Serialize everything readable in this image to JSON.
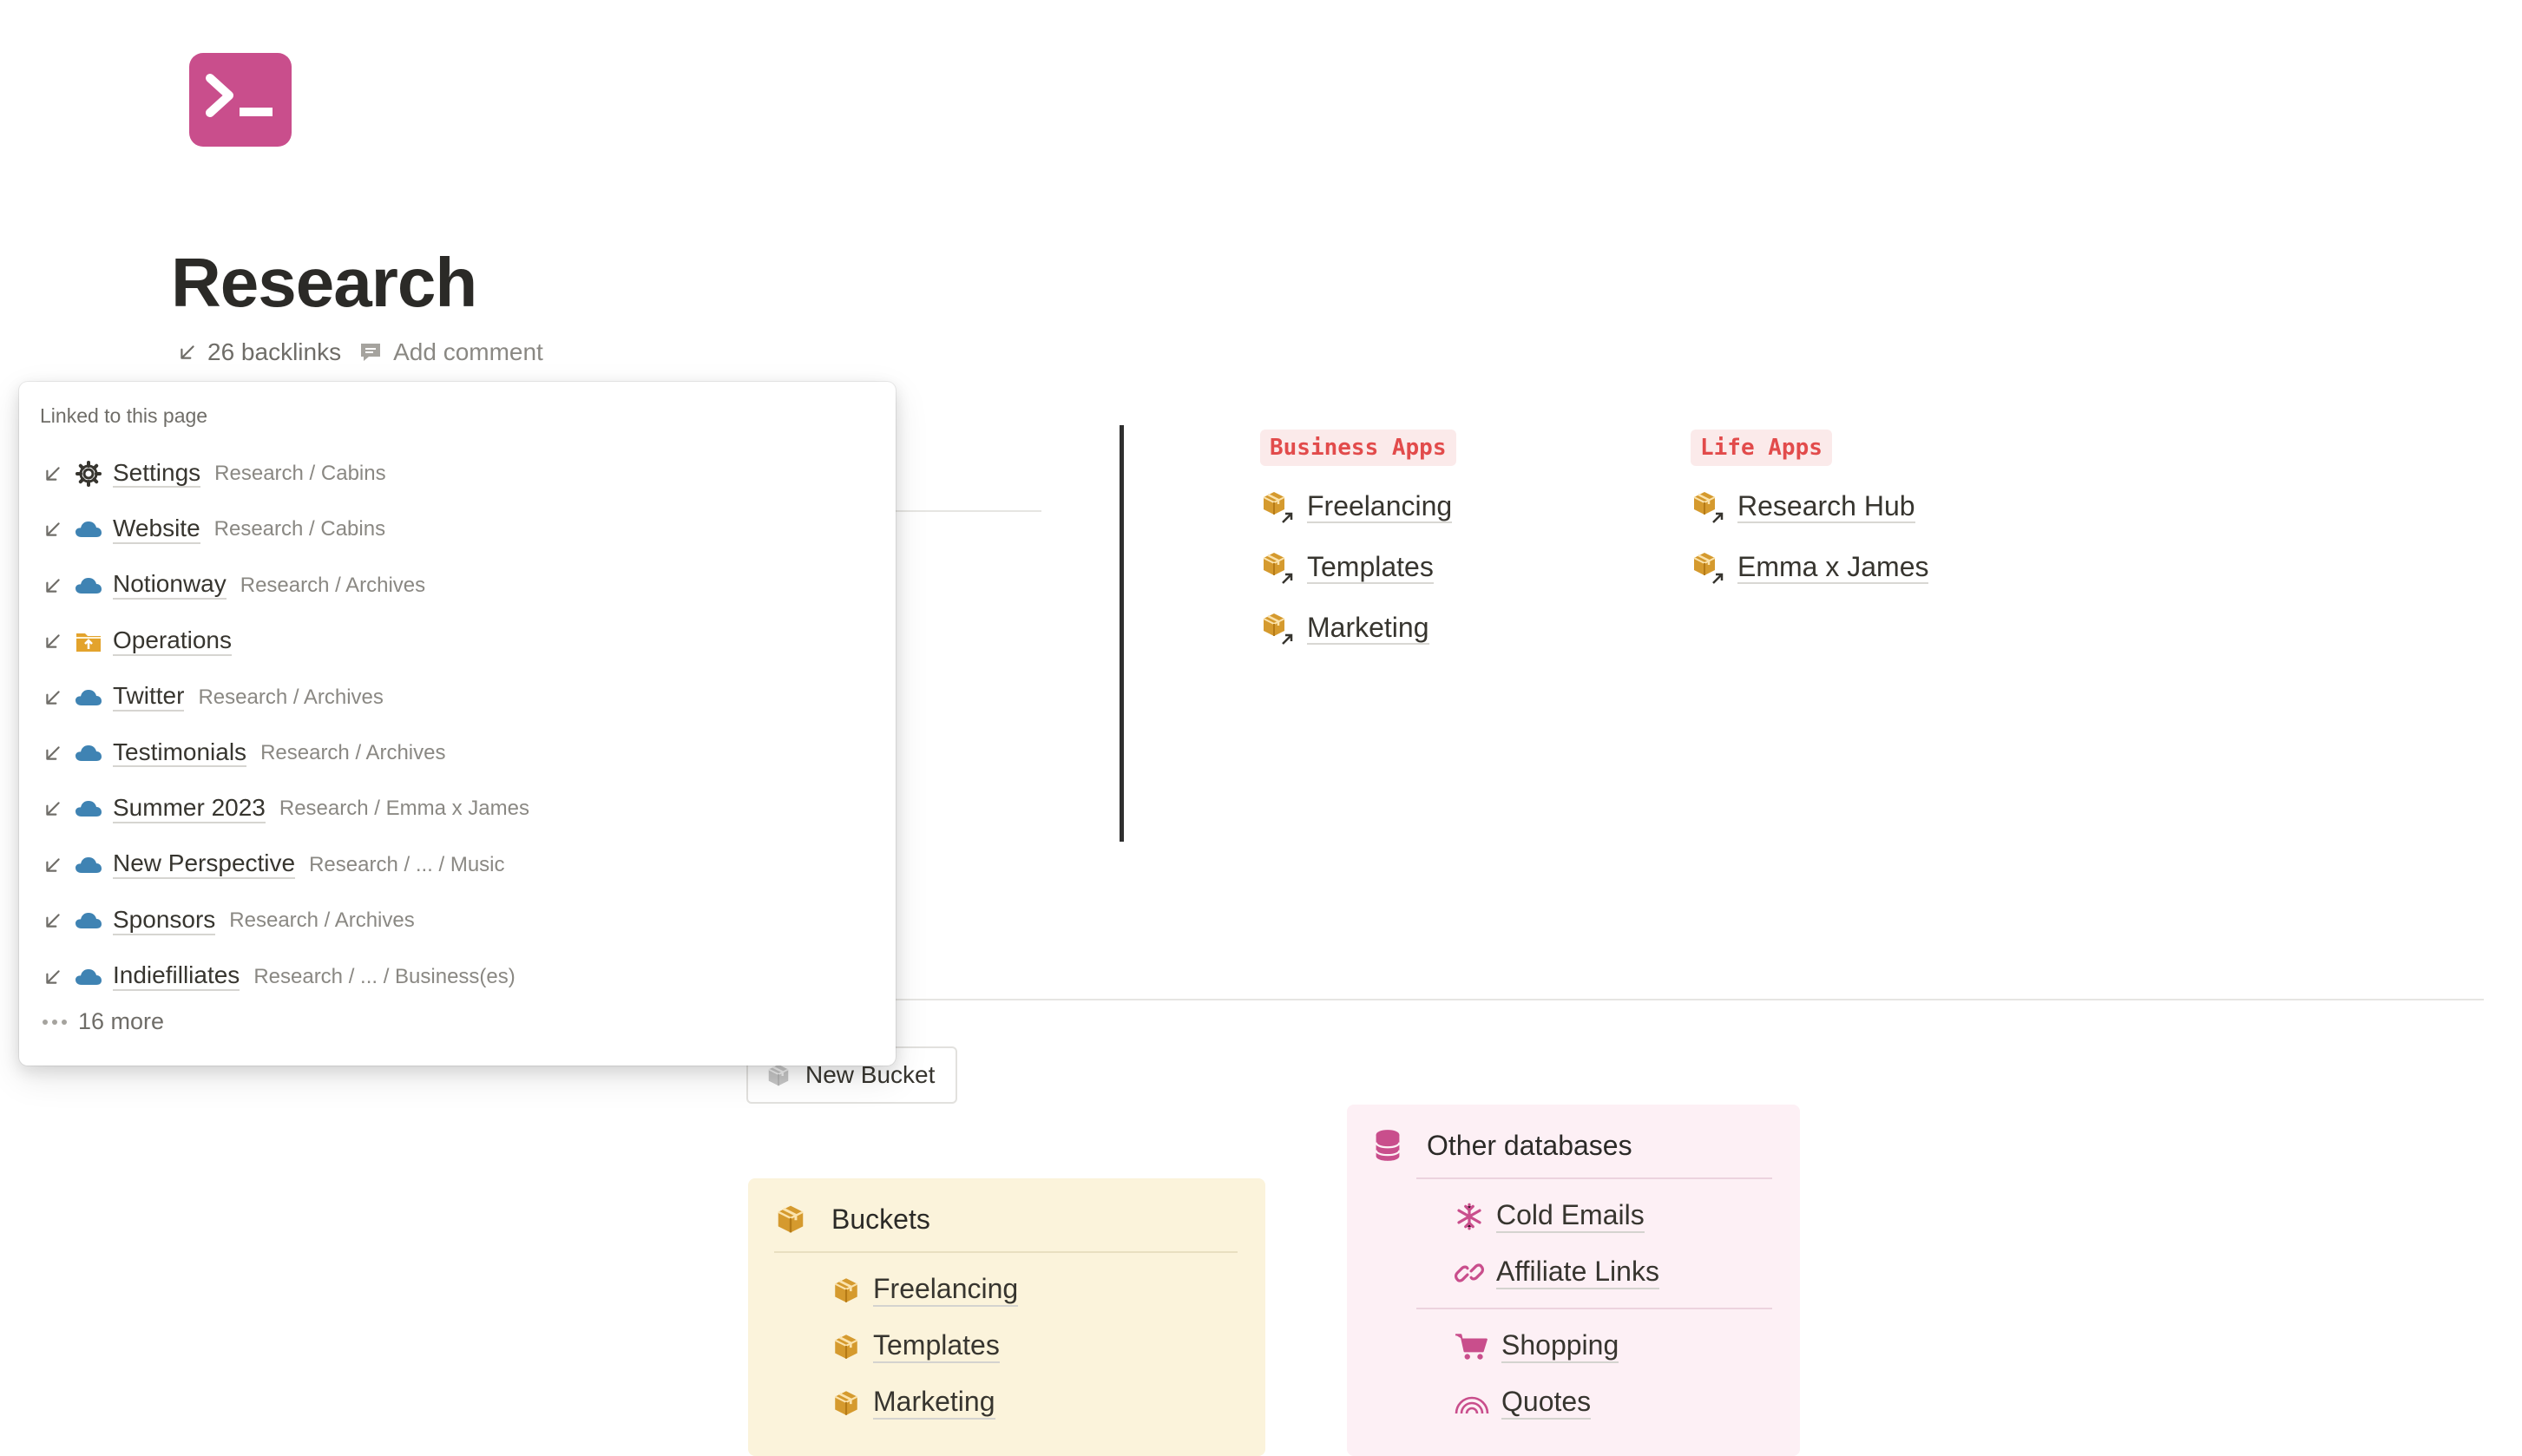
{
  "page": {
    "title": "Research",
    "backlinks_label": "26 backlinks",
    "add_comment_label": "Add comment",
    "icon": "terminal-icon",
    "accent_color": "#c94e8c"
  },
  "apps": {
    "business": {
      "tag": "Business Apps",
      "items": [
        {
          "label": "Freelancing",
          "icon": "box-link-icon"
        },
        {
          "label": "Templates",
          "icon": "box-link-icon"
        },
        {
          "label": "Marketing",
          "icon": "box-link-icon"
        }
      ]
    },
    "life": {
      "tag": "Life Apps",
      "items": [
        {
          "label": "Research Hub",
          "icon": "box-link-icon"
        },
        {
          "label": "Emma x James",
          "icon": "box-link-icon"
        }
      ]
    }
  },
  "new_bucket": {
    "label": "New Bucket"
  },
  "buckets": {
    "title": "Buckets",
    "bg_color": "#fbf3db",
    "items": [
      "Freelancing",
      "Templates",
      "Marketing"
    ]
  },
  "other_databases": {
    "title": "Other databases",
    "bg_color": "#fdf0f5",
    "group1": [
      {
        "label": "Cold Emails",
        "icon": "snowflake-icon"
      },
      {
        "label": "Affiliate Links",
        "icon": "link-icon"
      }
    ],
    "group2": [
      {
        "label": "Shopping",
        "icon": "cart-icon"
      },
      {
        "label": "Quotes",
        "icon": "rainbow-icon"
      }
    ]
  },
  "backlinks_popup": {
    "header": "Linked to this page",
    "items": [
      {
        "title": "Settings",
        "path": "Research / Cabins",
        "icon": "gear-icon"
      },
      {
        "title": "Website",
        "path": "Research / Cabins",
        "icon": "cloud-icon"
      },
      {
        "title": "Notionway",
        "path": "Research / Archives",
        "icon": "cloud-icon"
      },
      {
        "title": "Operations",
        "path": "",
        "icon": "folder-icon"
      },
      {
        "title": "Twitter",
        "path": "Research / Archives",
        "icon": "cloud-icon"
      },
      {
        "title": "Testimonials",
        "path": "Research / Archives",
        "icon": "cloud-icon"
      },
      {
        "title": "Summer 2023",
        "path": "Research / Emma x James",
        "icon": "cloud-icon"
      },
      {
        "title": "New Perspective",
        "path": "Research / ... / Music",
        "icon": "cloud-icon"
      },
      {
        "title": "Sponsors",
        "path": "Research / Archives",
        "icon": "cloud-icon"
      },
      {
        "title": "Indiefilliates",
        "path": "Research / ... / Business(es)",
        "icon": "cloud-icon"
      }
    ],
    "more_label": "16 more"
  }
}
